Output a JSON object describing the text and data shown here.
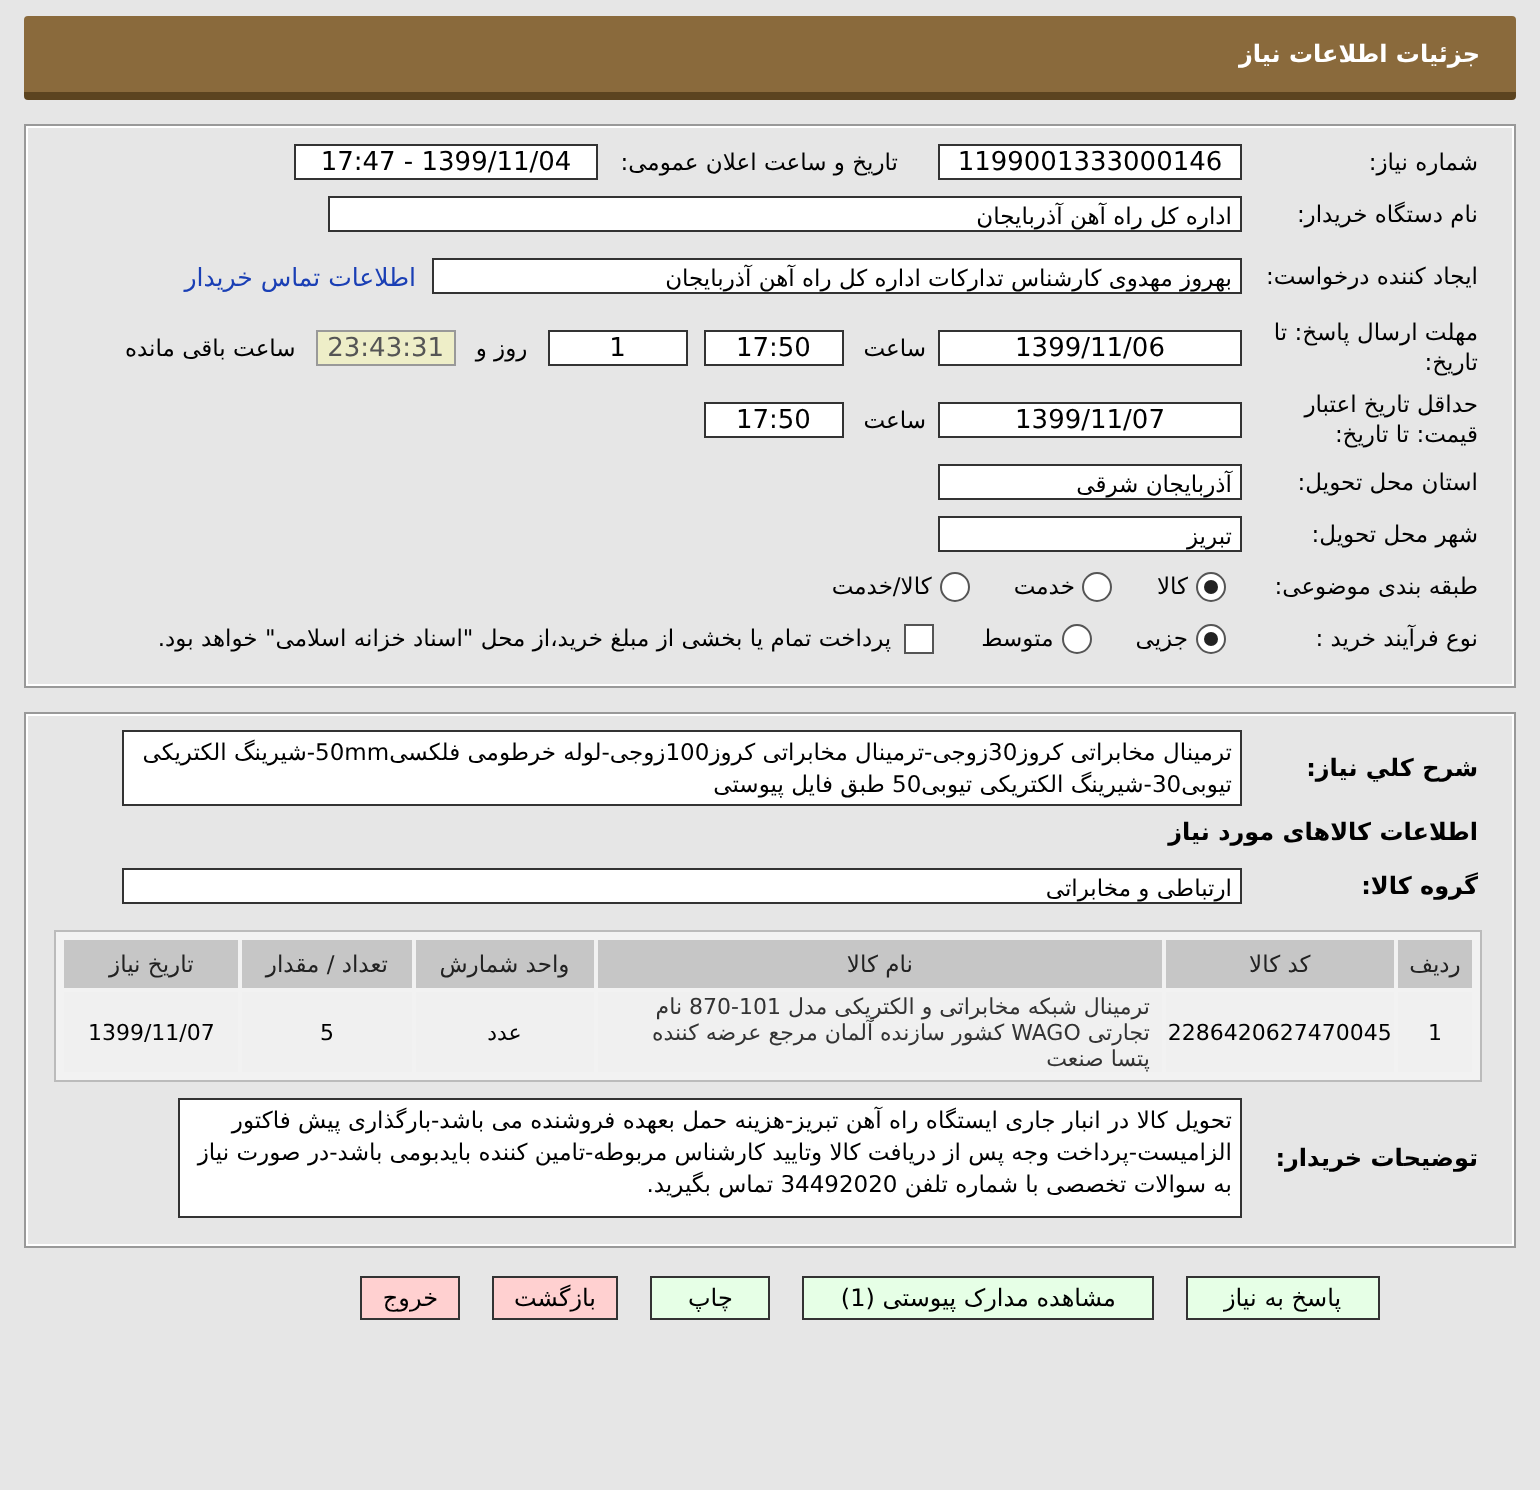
{
  "header": {
    "title": "جزئیات اطلاعات نیاز"
  },
  "need": {
    "need_number": {
      "label": "شماره نیاز:",
      "value": "1199001333000146"
    },
    "announce": {
      "label": "تاریخ و ساعت اعلان عمومی:",
      "value": "1399/11/04 - 17:47"
    },
    "buyer": {
      "label": "نام دستگاه خریدار:",
      "value": "اداره کل راه آهن آذربایجان"
    },
    "creator": {
      "label": "ایجاد کننده درخواست:",
      "value": "بهروز مهدوی کارشناس تدارکات اداره کل راه آهن آذربایجان",
      "link": "اطلاعات تماس خریدار"
    },
    "deadline": {
      "label": "مهلت ارسال پاسخ: تا تاریخ:",
      "date": "1399/11/06",
      "time_label": "ساعت",
      "time": "17:50",
      "days": "1",
      "days_label": "روز و",
      "remaining": "23:43:31",
      "remaining_label": "ساعت باقی مانده"
    },
    "validity": {
      "label": "حداقل تاریخ اعتبار قیمت: تا تاریخ:",
      "date": "1399/11/07",
      "time_label": "ساعت",
      "time": "17:50"
    },
    "province": {
      "label": "استان محل تحویل:",
      "value": "آذربایجان شرقی"
    },
    "city": {
      "label": "شهر محل تحویل:",
      "value": "تبریز"
    },
    "category": {
      "label": "طبقه بندی موضوعی:",
      "options": [
        {
          "label": "کالا",
          "selected": true
        },
        {
          "label": "خدمت",
          "selected": false
        },
        {
          "label": "کالا/خدمت",
          "selected": false
        }
      ]
    },
    "process": {
      "label": "نوع فرآیند خرید :",
      "options": [
        {
          "label": "جزیی",
          "selected": true
        },
        {
          "label": "متوسط",
          "selected": false
        }
      ],
      "payment": {
        "label": "پرداخت تمام یا بخشی از مبلغ خرید،از محل \"اسناد خزانه اسلامی\" خواهد بود.",
        "checked": false
      }
    }
  },
  "details": {
    "description": {
      "label": "شرح كلي نياز:",
      "value": "ترمینال مخابراتی کروز30زوجی-ترمینال مخابراتی کروز100زوجی-لوله خرطومی فلکسی50mm-شیرینگ الکتریکی تیوبی30-شیرینگ الکتریکی تیوبی50 طبق فایل پیوستی"
    },
    "goods_heading": "اطلاعات کالاهای مورد نیاز",
    "group": {
      "label": "گروه کالا:",
      "value": "ارتباطی و مخابراتی"
    },
    "table": {
      "columns": [
        "ردیف",
        "کد کالا",
        "نام کالا",
        "واحد شمارش",
        "تعداد / مقدار",
        "تاریخ نیاز"
      ],
      "rows": [
        [
          "1",
          "2286420627470045",
          "ترمینال شبکه مخابراتی و الکتریکی مدل 101-870 نام تجارتی WAGO کشور سازنده آلمان مرجع عرضه کننده پتسا صنعت",
          "عدد",
          "5",
          "1399/11/07"
        ]
      ]
    },
    "notes": {
      "label": "توضیحات خریدار:",
      "value": "تحویل کالا در انبار جاری ایستگاه راه آهن تبریز-هزینه حمل بعهده فروشنده می باشد-بارگذاری پیش فاکتور الزامیست-پرداخت وجه پس از دریافت کالا وتایید کارشناس مربوطه-تامین کننده بایدبومی باشد-در صورت نیاز به سوالات تخصصی با شماره تلفن 34492020 تماس بگیرید."
    }
  },
  "buttons": [
    {
      "label": "پاسخ به نیاز",
      "kind": "action"
    },
    {
      "label": "مشاهده مدارک پیوستی (1)",
      "kind": "action"
    },
    {
      "label": "چاپ",
      "kind": "action"
    },
    {
      "label": "بازگشت",
      "kind": "exit"
    },
    {
      "label": "خروج",
      "kind": "exit"
    }
  ]
}
